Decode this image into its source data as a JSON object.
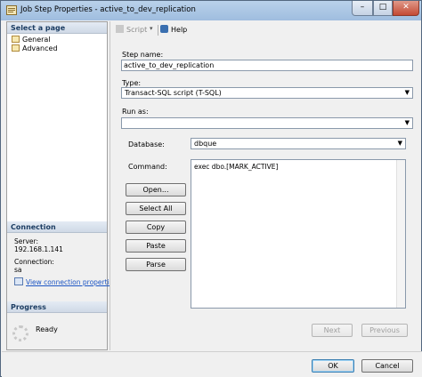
{
  "window": {
    "title": "Job Step Properties - active_to_dev_replication"
  },
  "left": {
    "select_page_header": "Select a page",
    "pages": [
      {
        "label": "General"
      },
      {
        "label": "Advanced"
      }
    ],
    "connection_header": "Connection",
    "server_label": "Server:",
    "server_value": "192.168.1.141",
    "connection_label": "Connection:",
    "connection_value": "sa",
    "view_connection_link": "View connection properties",
    "progress_header": "Progress",
    "progress_status": "Ready"
  },
  "toolbar": {
    "script_label": "Script",
    "dropdown_glyph": "▾",
    "help_label": "Help"
  },
  "form": {
    "step_name_label": "Step name:",
    "step_name_value": "active_to_dev_replication",
    "type_label": "Type:",
    "type_value": "Transact-SQL script (T-SQL)",
    "run_as_label": "Run as:",
    "run_as_value": "",
    "database_label": "Database:",
    "database_value": "dbque",
    "command_label": "Command:",
    "command_value": "exec dbo.[MARK_ACTIVE]",
    "buttons": {
      "open": "Open...",
      "select_all": "Select All",
      "copy": "Copy",
      "paste": "Paste",
      "parse": "Parse"
    },
    "next_label": "Next",
    "previous_label": "Previous"
  },
  "footer": {
    "ok_label": "OK",
    "cancel_label": "Cancel"
  }
}
